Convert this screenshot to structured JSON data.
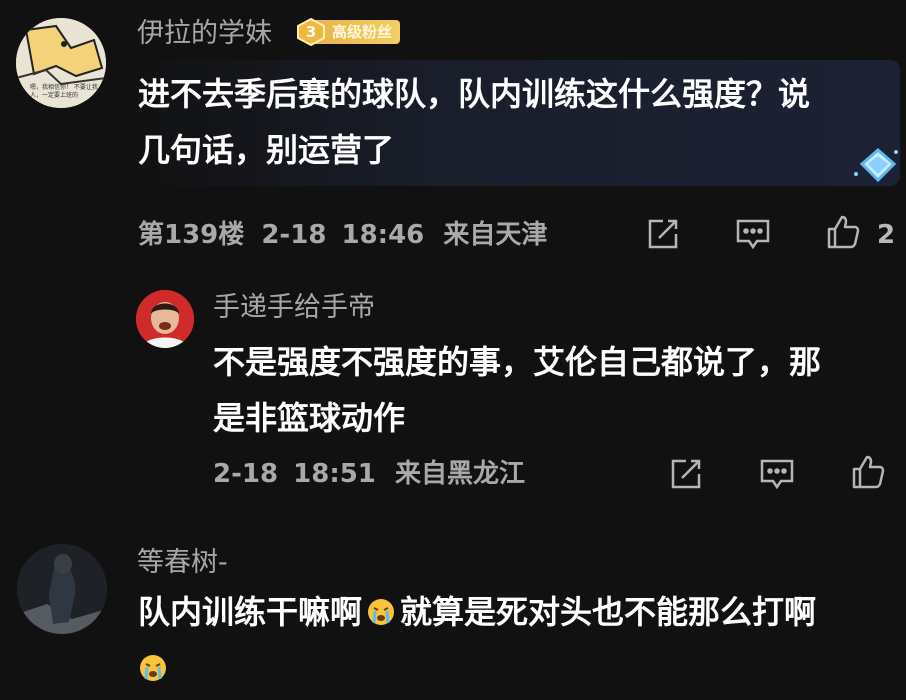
{
  "comments": [
    {
      "username": "伊拉的学妹",
      "badge_level": "3",
      "badge_label": "高级粉丝",
      "avatar_text_1": "嗯，我相信你！ 不要让我，",
      "avatar_text_2": "人，一定要上班的",
      "text_line1": "进不去季后赛的球队，队内训练这什么强度？说",
      "text_line2": "几句话，别运营了",
      "floor": "第139楼",
      "date": "2-18",
      "time": "18:46",
      "location": "来自天津",
      "likes": "2"
    },
    {
      "username": "手递手给手帝",
      "text_line1": "不是强度不强度的事，艾伦自己都说了，那",
      "text_line2": "是非篮球动作",
      "date": "2-18",
      "time": "18:51",
      "location": "来自黑龙江"
    },
    {
      "username": "等春树-",
      "text_part1": "队内训练干嘛啊",
      "text_part2": "就算是死对头也不能那么打啊"
    }
  ],
  "icons": {
    "share": "share-icon",
    "reply": "comment-icon",
    "like": "thumbs-up-icon",
    "emoji": "crying-emoji-icon"
  },
  "colors": {
    "background": "#111111",
    "username": "#a7a7a7",
    "meta": "#a9a9a9",
    "badge": "#f0c154",
    "highlight": "#1c2234"
  }
}
